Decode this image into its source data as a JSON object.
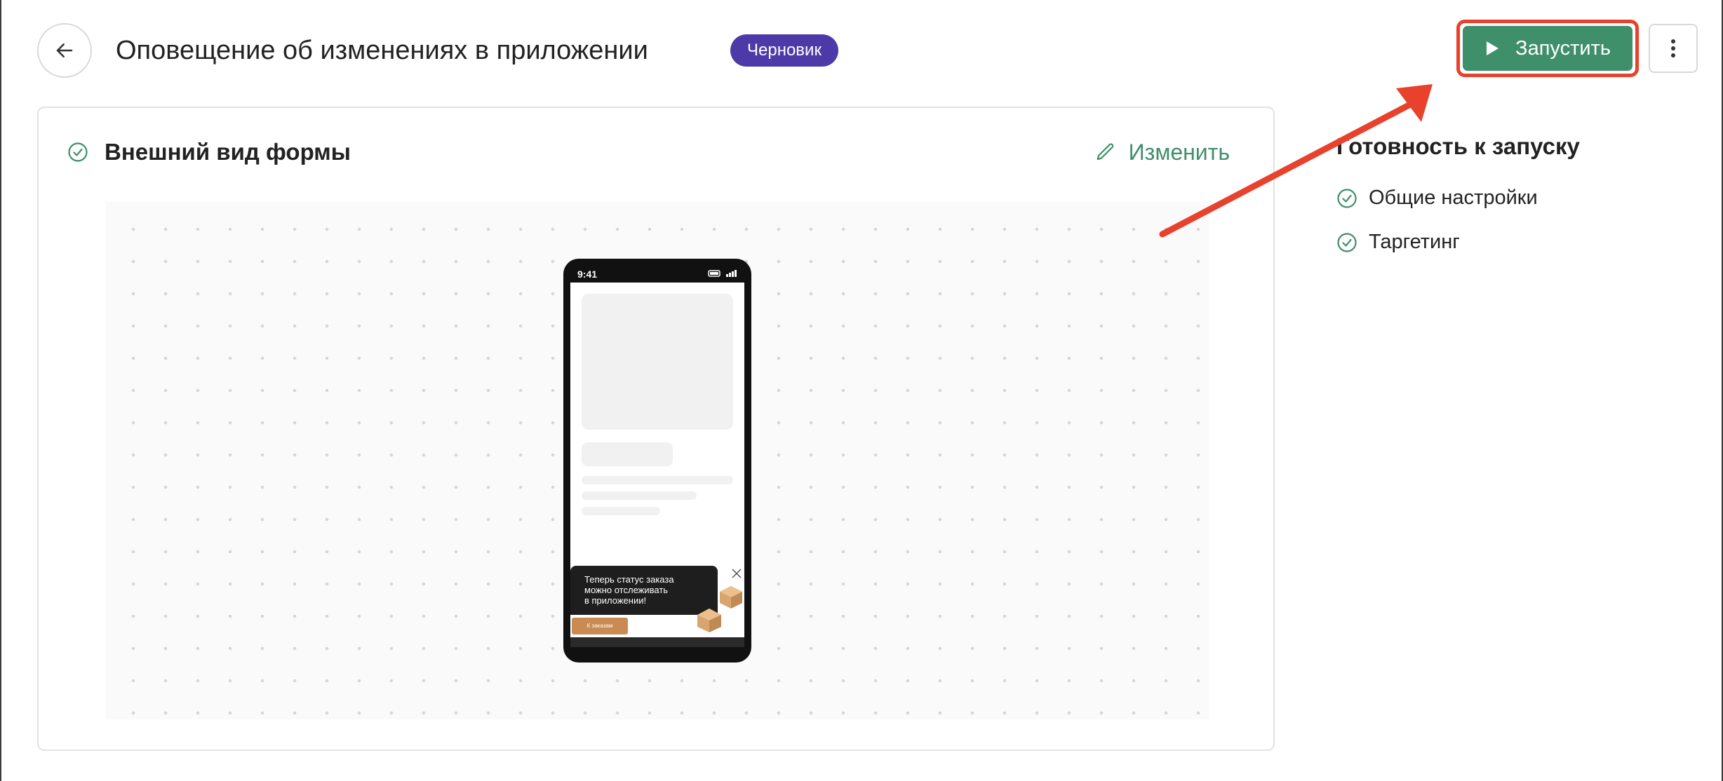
{
  "header": {
    "title": "Оповещение об изменениях в приложении",
    "status_badge": "Черновик",
    "launch_label": "Запустить",
    "icons": {
      "back": "arrow-left-icon",
      "launch": "play-icon",
      "more": "more-vertical-icon"
    }
  },
  "card": {
    "title": "Внешний вид формы",
    "edit_label": "Изменить",
    "icons": {
      "status": "check-circle-icon",
      "edit": "pencil-icon"
    }
  },
  "phone_preview": {
    "time": "9:41",
    "popup_lines": [
      "Теперь статус заказа",
      "можно отслеживать",
      "в приложении!"
    ],
    "popup_button": "К заказам"
  },
  "readiness": {
    "title": "Готовность к запуску",
    "items": [
      {
        "label": "Общие настройки",
        "icon": "check-circle-icon"
      },
      {
        "label": "Таргетинг",
        "icon": "check-circle-icon"
      }
    ]
  },
  "colors": {
    "accent_green": "#3f8f6a",
    "badge_purple": "#4d3aa8",
    "annotation_red": "#e8412c"
  }
}
